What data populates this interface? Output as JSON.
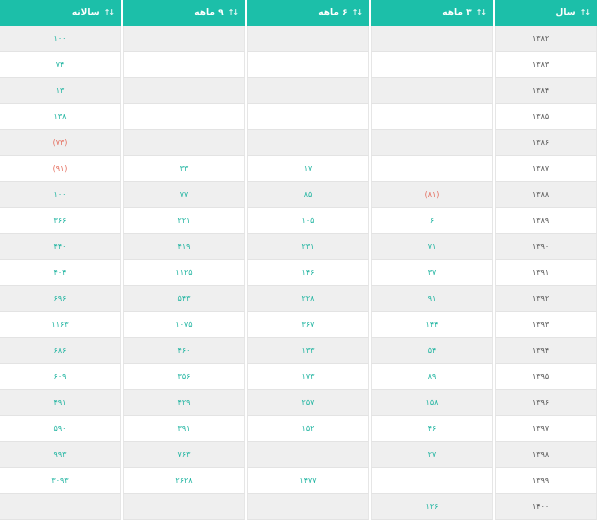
{
  "headers": {
    "year": "سال",
    "q3": "۳ ماهه",
    "q6": "۶ ماهه",
    "q9": "۹ ماهه",
    "annual": "سالانه"
  },
  "rows": [
    {
      "year": "۱۳۸۲",
      "q3": "",
      "q6": "",
      "q9": "",
      "annual": "۱۰۰"
    },
    {
      "year": "۱۳۸۳",
      "q3": "",
      "q6": "",
      "q9": "",
      "annual": "۷۴"
    },
    {
      "year": "۱۳۸۴",
      "q3": "",
      "q6": "",
      "q9": "",
      "annual": "۱۳"
    },
    {
      "year": "۱۳۸۵",
      "q3": "",
      "q6": "",
      "q9": "",
      "annual": "۱۳۸"
    },
    {
      "year": "۱۳۸۶",
      "q3": "",
      "q6": "",
      "q9": "",
      "annual": "(۷۳)"
    },
    {
      "year": "۱۳۸۷",
      "q3": "",
      "q6": "۱۷",
      "q9": "۳۳",
      "annual": "(۹۱)"
    },
    {
      "year": "۱۳۸۸",
      "q3": "(۸۱)",
      "q6": "۸۵",
      "q9": "۷۷",
      "annual": "۱۰۰"
    },
    {
      "year": "۱۳۸۹",
      "q3": "۶",
      "q6": "۱۰۵",
      "q9": "۲۲۱",
      "annual": "۳۶۶"
    },
    {
      "year": "۱۳۹۰",
      "q3": "۷۱",
      "q6": "۲۳۱",
      "q9": "۴۱۹",
      "annual": "۴۴۰"
    },
    {
      "year": "۱۳۹۱",
      "q3": "۳۷",
      "q6": "۱۴۶",
      "q9": "۱۱۲۵",
      "annual": "۴۰۴"
    },
    {
      "year": "۱۳۹۲",
      "q3": "۹۱",
      "q6": "۲۲۸",
      "q9": "۵۴۳",
      "annual": "۶۹۶"
    },
    {
      "year": "۱۳۹۳",
      "q3": "۱۴۴",
      "q6": "۳۶۷",
      "q9": "۱۰۷۵",
      "annual": "۱۱۶۳"
    },
    {
      "year": "۱۳۹۴",
      "q3": "۵۴",
      "q6": "۱۳۳",
      "q9": "۴۶۰",
      "annual": "۶۸۶"
    },
    {
      "year": "۱۳۹۵",
      "q3": "۸۹",
      "q6": "۱۷۳",
      "q9": "۳۵۶",
      "annual": "۶۰۹"
    },
    {
      "year": "۱۳۹۶",
      "q3": "۱۵۸",
      "q6": "۲۵۷",
      "q9": "۴۲۹",
      "annual": "۴۹۱"
    },
    {
      "year": "۱۳۹۷",
      "q3": "۴۶",
      "q6": "۱۵۲",
      "q9": "۳۹۱",
      "annual": "۵۹۰"
    },
    {
      "year": "۱۳۹۸",
      "q3": "۲۷",
      "q6": "",
      "q9": "۷۶۳",
      "annual": "۹۹۳"
    },
    {
      "year": "۱۳۹۹",
      "q3": "",
      "q6": "۱۴۷۷",
      "q9": "۲۶۲۸",
      "annual": "۳۰۹۳"
    },
    {
      "year": "۱۴۰۰",
      "q3": "۱۲۶",
      "q6": "",
      "q9": "",
      "annual": ""
    }
  ],
  "colors": {
    "header_bg": "#1cbfa9",
    "value": "#1cb39f",
    "negative": "#e46a5a",
    "year": "#555555",
    "zebra": "#efefef"
  }
}
